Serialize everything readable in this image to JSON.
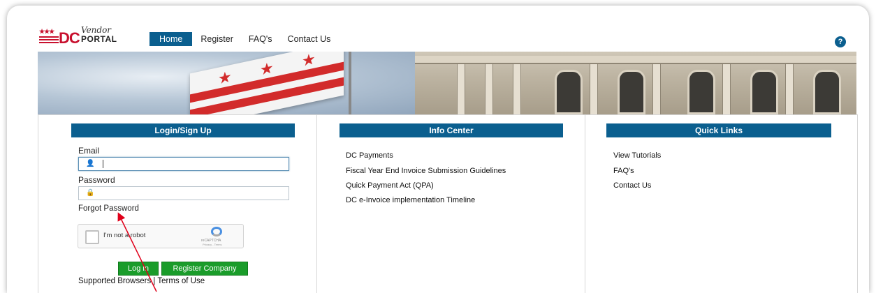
{
  "nav": {
    "logo_prefix": "DC",
    "logo_vendor": "Vendor",
    "logo_portal": "PORTAL",
    "items": [
      {
        "label": "Home",
        "active": true
      },
      {
        "label": "Register"
      },
      {
        "label": "FAQ's"
      },
      {
        "label": "Contact Us"
      }
    ],
    "help_icon": "?"
  },
  "login": {
    "header": "Login/Sign Up",
    "email_label": "Email",
    "password_label": "Password",
    "forgot": "Forgot Password",
    "captcha_text": "I'm not a robot",
    "captcha_brand": "reCAPTCHA",
    "captcha_terms": "Privacy - Terms",
    "login_button": "Log in",
    "register_button": "Register Company",
    "supported": "Supported Browsers | Terms of Use"
  },
  "info_center": {
    "header": "Info Center",
    "links": [
      "DC Payments",
      "Fiscal Year End Invoice Submission Guidelines",
      "Quick Payment Act (QPA)",
      "DC e-Invoice implementation Timeline"
    ]
  },
  "quick_links": {
    "header": "Quick Links",
    "links": [
      "View Tutorials",
      "FAQ's",
      "Contact Us"
    ]
  },
  "colors": {
    "brand_blue": "#0b5f8f",
    "brand_red": "#c8102e",
    "button_green": "#1a9c2a",
    "annotation_arrow": "#e0001a"
  }
}
